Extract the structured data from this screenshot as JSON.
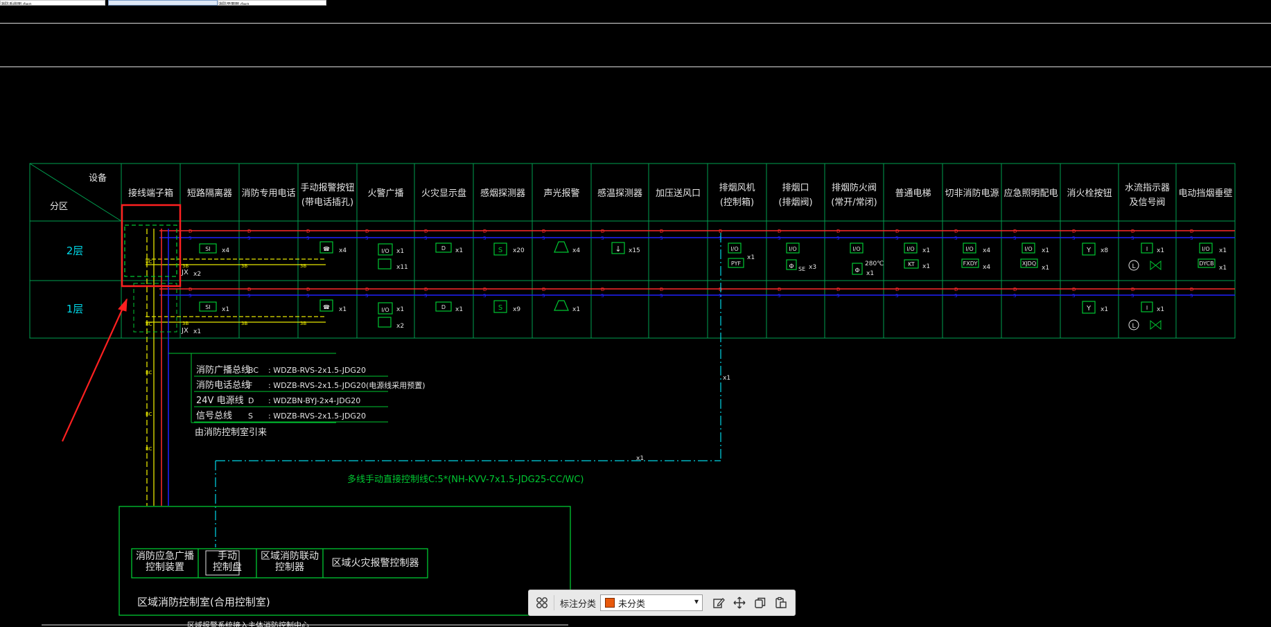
{
  "tabs": [
    {
      "label": "消防系统图.dwg"
    },
    {
      "label": ""
    },
    {
      "label": "消防平面图.dwg"
    }
  ],
  "table": {
    "corner_device": "设备",
    "corner_zone": "分区",
    "headers": [
      "接线端子箱",
      "短路隔离器",
      "消防专用电话",
      "手动报警按钮|(带电话插孔)",
      "火警广播",
      "火灾显示盘",
      "感烟探测器",
      "声光报警",
      "感温探测器",
      "加压送风口",
      "排烟风机|(控制箱)",
      "排烟口|(排烟阀)",
      "排烟防火阀|(常开/常闭)",
      "普通电梯",
      "切非消防电源",
      "应急照明配电",
      "消火栓按钮",
      "水流指示器|及信号阀",
      "电动挡烟垂壁"
    ],
    "rows": [
      "2层",
      "1层"
    ],
    "floor2_marks": [
      "x2",
      "x4",
      "x4",
      "x1",
      "x11",
      "x1",
      "x20",
      "x4",
      "x15",
      "x1",
      "x3",
      "x1",
      "x1",
      "x4",
      "x1",
      "x8",
      "x1",
      "x1"
    ],
    "floor1_marks": [
      "x1",
      "x1",
      "x2",
      "x1",
      "x9",
      "x1",
      "x1",
      "x1"
    ],
    "jx_label": "JX",
    "symbols": {
      "isolator": "SI",
      "damper_code": "280℃",
      "fan_code": "PYF",
      "smoke_code": "SE",
      "elevator_code": "KT",
      "power_code": "FXDY",
      "light_code": "XJDQ",
      "curtain_code": "DYCB",
      "vo": "I/O",
      "i": "I"
    },
    "bus_letters": {
      "broadcast": "BC",
      "phone": "F",
      "power": "D",
      "signal": "S",
      "control": "C"
    }
  },
  "legend": [
    {
      "name": "消防广播总线",
      "code": "BC",
      "spec": "WDZB-RVS-2x1.5-JDG20"
    },
    {
      "name": "消防电话总线",
      "code": "F",
      "spec": "WDZB-RVS-2x1.5-JDG20(电源线采用预置)"
    },
    {
      "name": "24V 电源线",
      "code": "D",
      "spec": "WDZBN-BYJ-2x4-JDG20"
    },
    {
      "name": "信号总线",
      "code": "S",
      "spec": "WDZB-RVS-2x1.5-JDG20"
    }
  ],
  "legend_source": "由消防控制室引来",
  "control_line_label": "多线手动直接控制线C:5*(NH-KVV-7x1.5-JDG25-CC/WC)",
  "x1_label": "x1",
  "control_room": {
    "title": "区域消防控制室(合用控制室)",
    "boxes": [
      "消防应急广播|控制装置",
      "手动|控制盘",
      "区域消防联动|控制器",
      "区域火灾报警控制器"
    ]
  },
  "bottom_text": "区域报警系统接入主体消防控制中心",
  "toolbar": {
    "label": "标注分类",
    "selected": "未分类",
    "swatch_color": "#e8590c"
  },
  "colors": {
    "red": "#ff2a2a",
    "blue": "#2020ff",
    "green": "#00c832",
    "yellow": "#e6e600",
    "cyan": "#00d8e8",
    "highlight": "#ff2020",
    "gridline": "#00a050"
  }
}
